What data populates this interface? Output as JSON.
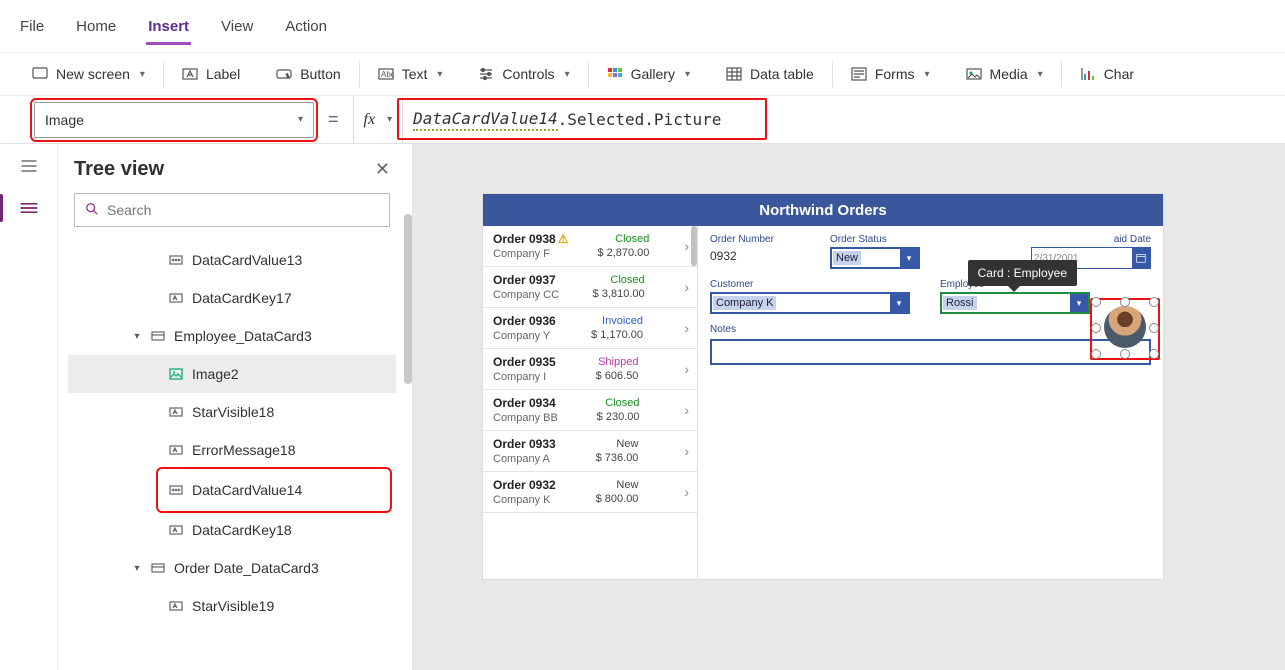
{
  "menu": {
    "file": "File",
    "home": "Home",
    "insert": "Insert",
    "view": "View",
    "action": "Action",
    "active": "insert"
  },
  "toolbar": {
    "new_screen": "New screen",
    "label": "Label",
    "button": "Button",
    "text": "Text",
    "controls": "Controls",
    "gallery": "Gallery",
    "data_table": "Data table",
    "forms": "Forms",
    "media": "Media",
    "chart": "Char"
  },
  "formula": {
    "property": "Image",
    "fx_symbol_part": "DataCardValue14",
    "fx_rest": ".Selected.Picture"
  },
  "tree": {
    "title": "Tree view",
    "search_placeholder": "Search",
    "nodes": {
      "dcv13": "DataCardValue13",
      "dck17": "DataCardKey17",
      "emp_card": "Employee_DataCard3",
      "image2": "Image2",
      "star18": "StarVisible18",
      "err18": "ErrorMessage18",
      "dcv14": "DataCardValue14",
      "dck18": "DataCardKey18",
      "orderdate_card": "Order Date_DataCard3",
      "star19": "StarVisible19"
    }
  },
  "app": {
    "title": "Northwind Orders",
    "orders": [
      {
        "name": "Order 0938",
        "warn": true,
        "company": "Company F",
        "status": "Closed",
        "status_cls": "closed",
        "amount": "$ 2,870.00"
      },
      {
        "name": "Order 0937",
        "company": "Company CC",
        "status": "Closed",
        "status_cls": "closed",
        "amount": "$ 3,810.00"
      },
      {
        "name": "Order 0936",
        "company": "Company Y",
        "status": "Invoiced",
        "status_cls": "invoiced",
        "amount": "$ 1,170.00"
      },
      {
        "name": "Order 0935",
        "company": "Company I",
        "status": "Shipped",
        "status_cls": "shipped",
        "amount": "$ 606.50"
      },
      {
        "name": "Order 0934",
        "company": "Company BB",
        "status": "Closed",
        "status_cls": "closed",
        "amount": "$ 230.00"
      },
      {
        "name": "Order 0933",
        "company": "Company A",
        "status": "New",
        "status_cls": "new",
        "amount": "$ 736.00"
      },
      {
        "name": "Order 0932",
        "company": "Company K",
        "status": "New",
        "status_cls": "new",
        "amount": "$ 800.00"
      }
    ],
    "form": {
      "order_number_label": "Order Number",
      "order_number": "0932",
      "order_status_label": "Order Status",
      "order_status": "New",
      "paid_date_label": "aid Date",
      "paid_date": "2/31/2001",
      "customer_label": "Customer",
      "customer": "Company K",
      "employee_label": "Employee",
      "employee": "Rossi",
      "notes_label": "Notes",
      "tooltip": "Card : Employee"
    }
  }
}
